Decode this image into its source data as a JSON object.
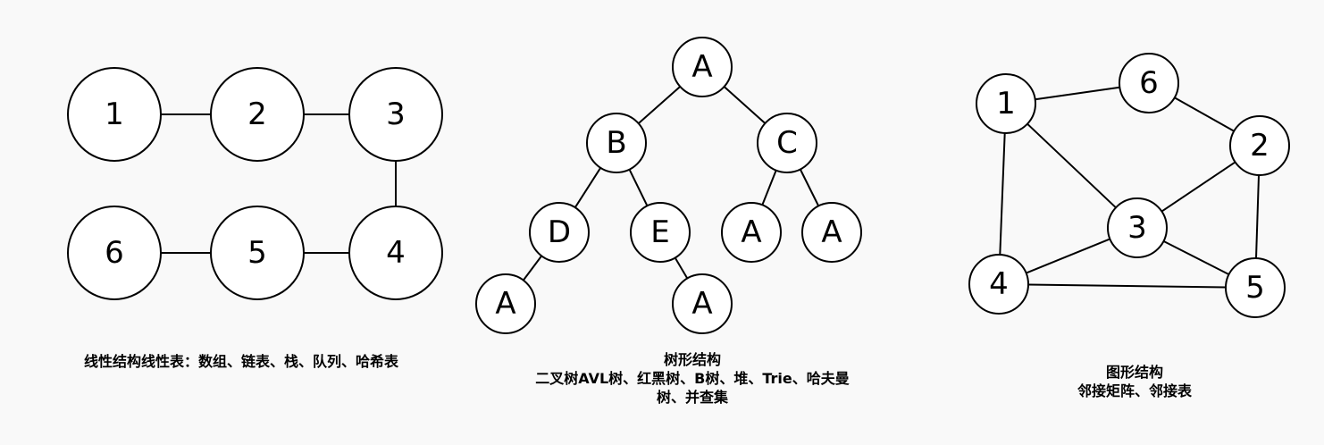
{
  "colors": {
    "background": "#f9f9f9",
    "node_fill": "#ffffff",
    "stroke": "#000000"
  },
  "linear": {
    "nodes": {
      "n1": "1",
      "n2": "2",
      "n3": "3",
      "n4": "4",
      "n5": "5",
      "n6": "6"
    },
    "edges": [
      [
        "n1",
        "n2"
      ],
      [
        "n2",
        "n3"
      ],
      [
        "n3",
        "n4"
      ],
      [
        "n4",
        "n5"
      ],
      [
        "n5",
        "n6"
      ]
    ],
    "caption": "线性结构线性表：数组、链表、栈、队列、哈希表"
  },
  "tree": {
    "nodes": {
      "a": "A",
      "b": "B",
      "c": "C",
      "d": "D",
      "e": "E",
      "ca": "A",
      "cb": "A",
      "da": "A",
      "ea": "A"
    },
    "edges": [
      [
        "a",
        "b"
      ],
      [
        "a",
        "c"
      ],
      [
        "b",
        "d"
      ],
      [
        "b",
        "e"
      ],
      [
        "c",
        "ca"
      ],
      [
        "c",
        "cb"
      ],
      [
        "d",
        "da"
      ],
      [
        "e",
        "ea"
      ]
    ],
    "caption_title": "树形结构",
    "caption_line2": "二叉树AVL树、红黑树、B树、堆、Trie、哈夫曼",
    "caption_line3": "树、并查集"
  },
  "graph": {
    "nodes": {
      "g1": "1",
      "g2": "2",
      "g3": "3",
      "g4": "4",
      "g5": "5",
      "g6": "6"
    },
    "edges": [
      [
        "g1",
        "g6"
      ],
      [
        "g6",
        "g2"
      ],
      [
        "g1",
        "g4"
      ],
      [
        "g1",
        "g3"
      ],
      [
        "g2",
        "g3"
      ],
      [
        "g2",
        "g5"
      ],
      [
        "g3",
        "g4"
      ],
      [
        "g3",
        "g5"
      ],
      [
        "g4",
        "g5"
      ]
    ],
    "caption_title": "图形结构",
    "caption_line2": "邻接矩阵、邻接表"
  }
}
